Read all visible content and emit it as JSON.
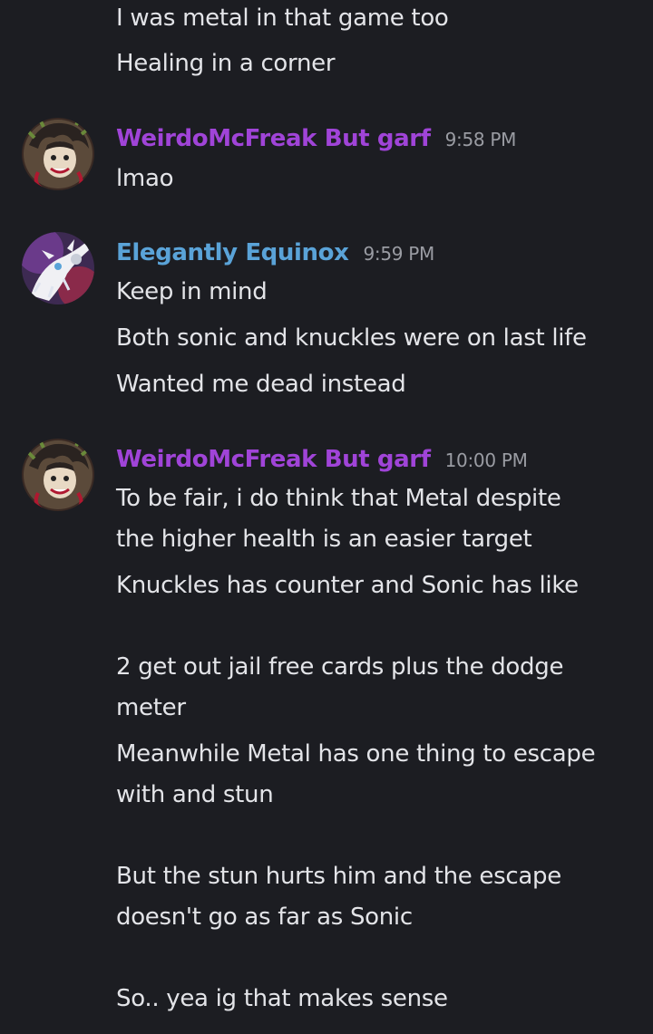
{
  "colors": {
    "background": "#1c1d22",
    "message_text": "#e3e4e8",
    "timestamp": "#9a9ca3",
    "user_weirdo": "#a044d8",
    "user_equinox": "#5aa3d8"
  },
  "messages": {
    "prev": {
      "lines": [
        "I was metal in that game too",
        "Healing in a corner"
      ]
    },
    "m1": {
      "author": "WeirdoMcFreak But garf",
      "author_color": "#a044d8",
      "avatar_icon": "anime-character-avatar",
      "time": "9:58 PM",
      "lines": [
        "lmao"
      ]
    },
    "m2": {
      "author": "Elegantly Equinox",
      "author_color": "#5aa3d8",
      "avatar_icon": "white-creature-avatar",
      "time": "9:59 PM",
      "lines": [
        "Keep in mind",
        "Both sonic and knuckles were on last life",
        "Wanted me dead instead"
      ]
    },
    "m3": {
      "author": "WeirdoMcFreak But garf",
      "author_color": "#a044d8",
      "avatar_icon": "anime-character-avatar",
      "time": "10:00 PM",
      "lines": [
        "To be fair, i do think that Metal despite",
        "the higher health is an easier target",
        "Knuckles has counter and Sonic has like",
        "2 get out jail free cards plus the dodge",
        "meter",
        "Meanwhile Metal has one thing to escape",
        "with and stun",
        "But the stun hurts him and the escape",
        "doesn't go as far as Sonic",
        "So.. yea ig that makes sense"
      ]
    }
  }
}
